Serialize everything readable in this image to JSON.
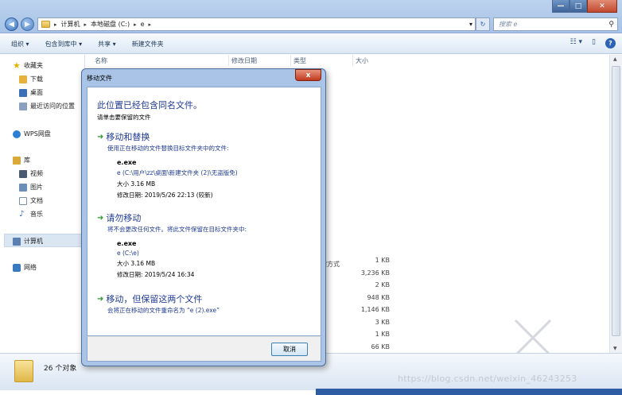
{
  "window": {
    "minimize": "—",
    "maximize": "□",
    "close": "✕"
  },
  "address": {
    "crumbs": [
      "计算机",
      "本地磁盘 (C:)",
      "e"
    ],
    "search_placeholder": "搜索 e"
  },
  "toolbar": {
    "organize": "组织 ▾",
    "include_library": "包含到库中 ▾",
    "share": "共享 ▾",
    "new_folder": "新建文件夹"
  },
  "nav": {
    "favorites": "收藏夹",
    "downloads": "下载",
    "desktop": "桌面",
    "recent": "最近访问的位置",
    "wps": "WPS网盘",
    "libraries": "库",
    "videos": "视频",
    "pictures": "图片",
    "documents": "文档",
    "music": "音乐",
    "computer": "计算机",
    "network": "网络"
  },
  "columns": {
    "name": "名称",
    "modified": "修改日期",
    "type": "类型",
    "size": "大小"
  },
  "list": {
    "type_fragment": "键方式",
    "sizes": [
      "1 KB",
      "3,236 KB",
      "2 KB",
      "948 KB",
      "1,146 KB",
      "3 KB",
      "1 KB",
      "66 KB"
    ]
  },
  "status": {
    "count": "26 个对象"
  },
  "watermark": "https://blog.csdn.net/weixin_46243253",
  "dialog": {
    "title": "移动文件",
    "close": "x",
    "headline": "此位置已经包含同名文件。",
    "subline": "请单击要保留的文件",
    "option1": {
      "title": "移动和替换",
      "desc": "使用正在移动的文件替换目标文件夹中的文件:",
      "file": "e.exe",
      "path": "e (C:\\用户\\zz\\桌面\\新建文件夹 (2)\\无盗版免)",
      "size": "大小 3.16 MB",
      "date": "修改日期: 2019/5/26 22:13 (较新)"
    },
    "option2": {
      "title": "请勿移动",
      "desc": "将不会更改任何文件。将此文件保留在目标文件夹中:",
      "file": "e.exe",
      "path": "e (C:\\e)",
      "size": "大小 3.16 MB",
      "date": "修改日期: 2019/5/24 16:34"
    },
    "option3": {
      "title": "移动，但保留这两个文件",
      "desc": "会将正在移动的文件重命名为 “e (2).exe”"
    },
    "cancel": "取消"
  }
}
